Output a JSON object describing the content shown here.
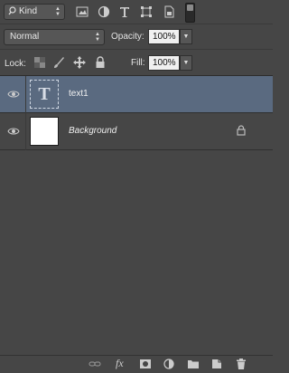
{
  "filter": {
    "kind_label": "Kind",
    "icons": [
      "pixel-filter-icon",
      "adjustment-filter-icon",
      "type-filter-icon",
      "shape-filter-icon",
      "smart-object-filter-icon",
      "filter-toggle-icon"
    ]
  },
  "blend": {
    "mode": "Normal",
    "opacity_label": "Opacity:",
    "opacity_value": "100%"
  },
  "lock": {
    "label": "Lock:",
    "fill_label": "Fill:",
    "fill_value": "100%"
  },
  "layers": [
    {
      "name": "text1",
      "type": "text",
      "selected": true,
      "thumb_glyph": "T",
      "visible": true
    },
    {
      "name": "Background",
      "type": "background",
      "selected": false,
      "locked": true,
      "visible": true
    }
  ],
  "footer": {
    "fx_label": "fx",
    "icons": [
      "link-layers-icon",
      "fx-icon",
      "add-mask-icon",
      "new-adjustment-icon",
      "new-group-icon",
      "new-layer-icon",
      "delete-layer-icon"
    ]
  },
  "colors": {
    "panel_bg": "#464646",
    "selected_bg": "#5a6a80"
  }
}
